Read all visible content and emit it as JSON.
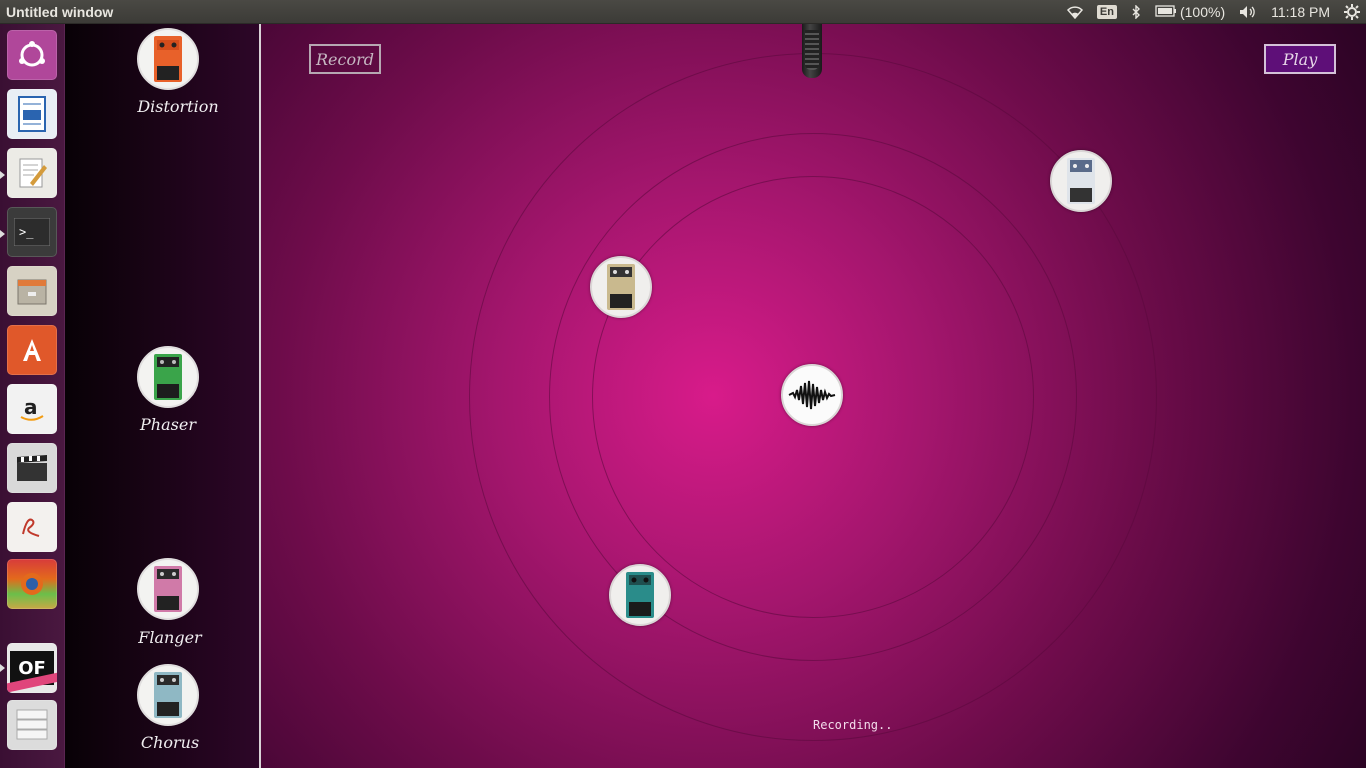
{
  "top_panel": {
    "window_title": "Untitled window",
    "keyboard_layout": "En",
    "battery_text": "(100%)",
    "clock": "11:18 PM",
    "icons": [
      "wifi-icon",
      "bluetooth-icon",
      "battery-icon",
      "volume-icon",
      "settings-gear-icon"
    ]
  },
  "launcher": {
    "items": [
      {
        "name": "ubuntu-dash",
        "glyph": "◎",
        "color": "#b0479a"
      },
      {
        "name": "libreoffice-writer",
        "glyph": "▤",
        "color": "#2a64b0"
      },
      {
        "name": "text-editor",
        "glyph": "✎",
        "color": "#e8e6dc"
      },
      {
        "name": "terminal",
        "glyph": ">_",
        "color": "#2c2c2c"
      },
      {
        "name": "files",
        "glyph": "▭",
        "color": "#c8c4b8"
      },
      {
        "name": "software-center",
        "glyph": "A",
        "color": "#e0582a"
      },
      {
        "name": "amazon",
        "glyph": "a",
        "color": "#f2f2f2"
      },
      {
        "name": "video-editor",
        "glyph": "🎬",
        "color": "#3a3a3a"
      },
      {
        "name": "pdf-viewer",
        "glyph": "ℯ",
        "color": "#f3f1ee"
      },
      {
        "name": "stacked-apps",
        "glyph": "◉",
        "color": "#e36a1c"
      },
      {
        "name": "openframeworks-debug",
        "glyph": "OF",
        "color": "#111111"
      },
      {
        "name": "workspaces",
        "glyph": "≣",
        "color": "#e6e6e6"
      }
    ]
  },
  "pedals": [
    {
      "name": "Distortion",
      "color": "#e8612a"
    },
    {
      "name": "Phaser",
      "color": "#3aa44a"
    },
    {
      "name": "Flanger",
      "color": "#d07aa8"
    },
    {
      "name": "Chorus",
      "color": "#8fb8c4"
    }
  ],
  "stage": {
    "record_label": "Record",
    "play_label": "Play",
    "status_text": "Recording..",
    "colors": {
      "center": "#d81b8a",
      "edge": "#2c0424",
      "play_bg": "#5e0f78"
    },
    "nodes": [
      {
        "kind": "pedal",
        "color": "#c9b98e"
      },
      {
        "kind": "pedal",
        "color": "#5a6b8a"
      },
      {
        "kind": "pedal",
        "color": "#2a8c8a"
      }
    ]
  }
}
